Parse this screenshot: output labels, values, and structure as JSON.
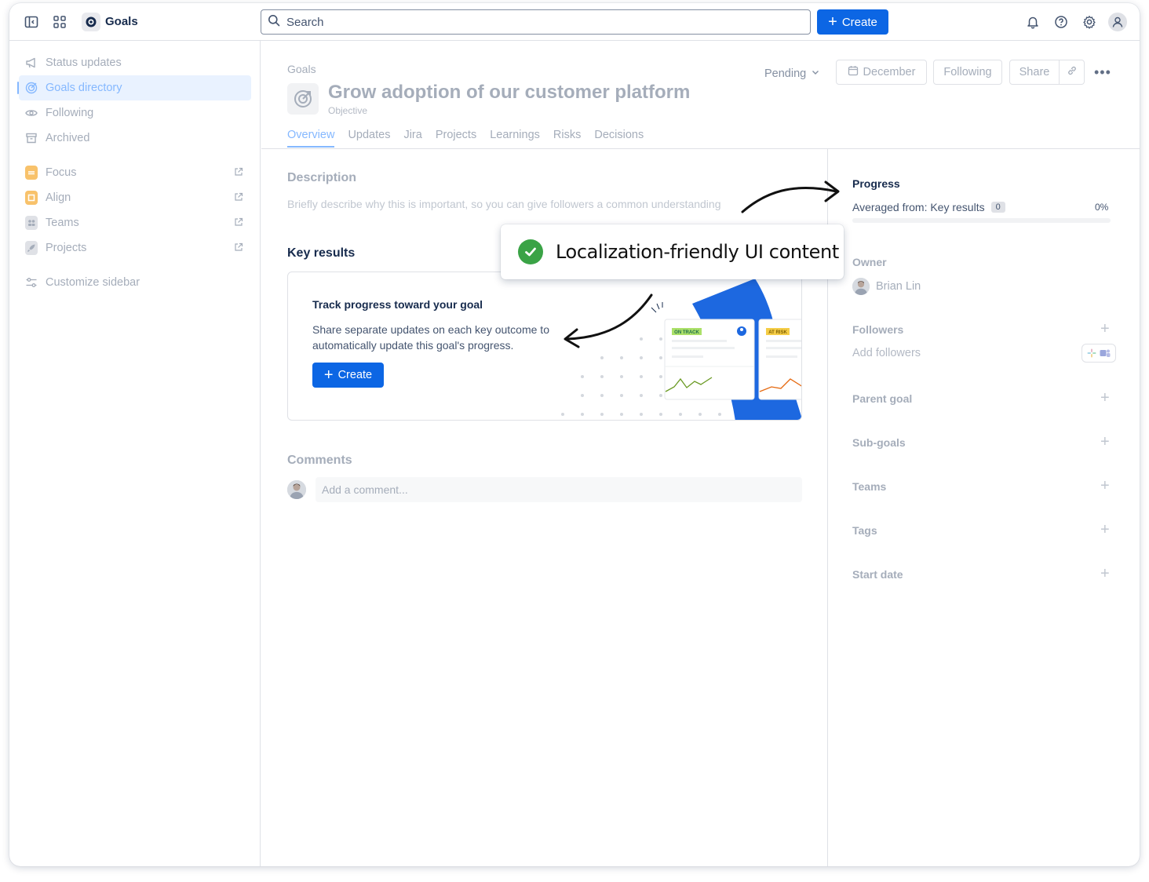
{
  "topnav": {
    "app_title": "Goals",
    "search_placeholder": "Search",
    "create_label": "Create"
  },
  "sidebar": {
    "items": [
      {
        "label": "Status updates",
        "icon": "megaphone-icon"
      },
      {
        "label": "Goals directory",
        "icon": "target-icon",
        "active": true
      },
      {
        "label": "Following",
        "icon": "eye-icon"
      },
      {
        "label": "Archived",
        "icon": "archive-icon"
      }
    ],
    "apps": [
      {
        "label": "Focus",
        "icon": "focus-app-icon",
        "color": "#f8c26b"
      },
      {
        "label": "Align",
        "icon": "align-app-icon",
        "color": "#f8c26b"
      },
      {
        "label": "Teams",
        "icon": "teams-app-icon",
        "color": "#dfe1e6"
      },
      {
        "label": "Projects",
        "icon": "rocket-icon",
        "color": "#dfe1e6"
      }
    ],
    "customize_label": "Customize sidebar"
  },
  "goal": {
    "breadcrumb": "Goals",
    "title": "Grow adoption of our customer platform",
    "type": "Objective",
    "status": "Pending",
    "target_date": "December",
    "following_label": "Following",
    "share_label": "Share",
    "tabs": [
      "Overview",
      "Updates",
      "Jira",
      "Projects",
      "Learnings",
      "Risks",
      "Decisions"
    ],
    "active_tab": "Overview"
  },
  "description": {
    "heading": "Description",
    "placeholder": "Briefly describe why this is important, so you can give followers a common understanding"
  },
  "key_results": {
    "heading": "Key results",
    "card_title": "Track progress toward your goal",
    "card_text": "Share separate updates on each key outcome to automatically update this goal's progress.",
    "create_label": "Create",
    "badge_on_track": "ON TRACK",
    "badge_at_risk": "AT RISK"
  },
  "comments": {
    "heading": "Comments",
    "placeholder": "Add a comment..."
  },
  "right_panel": {
    "progress_label": "Progress",
    "averaged_from": "Averaged from: Key results",
    "key_results_count": "0",
    "progress_percent": "0%",
    "owner_label": "Owner",
    "owner_name": "Brian Lin",
    "followers_label": "Followers",
    "add_followers": "Add followers",
    "parent_goal_label": "Parent goal",
    "sub_goals_label": "Sub-goals",
    "teams_label": "Teams",
    "tags_label": "Tags",
    "start_date_label": "Start date"
  },
  "callout": {
    "text": "Localization-friendly UI content",
    "check_color": "#3aa346"
  },
  "colors": {
    "primary": "#0c66e4",
    "active_nav": "#85b8ff",
    "on_track": "#abe069",
    "at_risk": "#f5cd47"
  }
}
